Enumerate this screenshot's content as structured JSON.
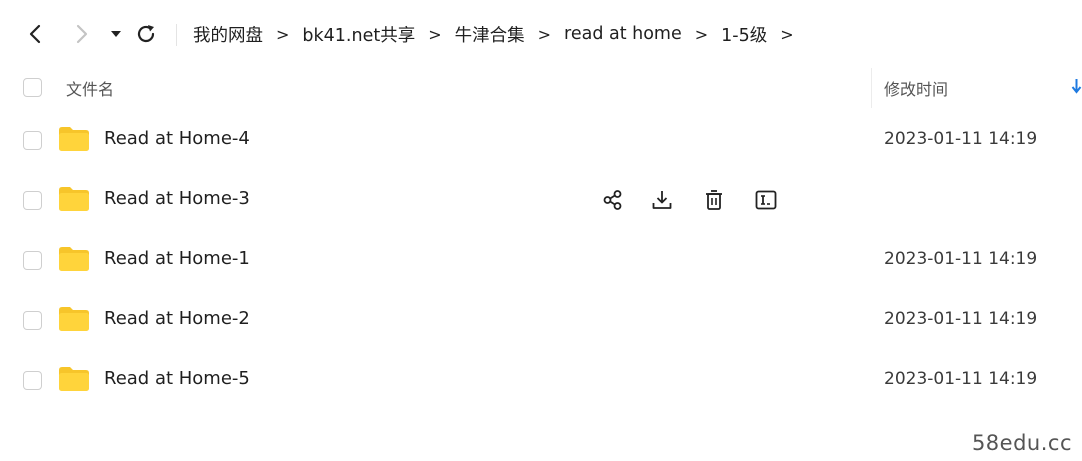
{
  "nav": {
    "back_icon": "chevron-left-icon",
    "forward_icon": "chevron-right-icon",
    "dropdown_icon": "caret-down-icon",
    "refresh_icon": "refresh-icon"
  },
  "breadcrumb": {
    "items": [
      "我的网盘",
      "bk41.net共享",
      "牛津合集",
      "read at home",
      "1-5级"
    ],
    "separator": ">"
  },
  "table": {
    "header_name": "文件名",
    "header_time": "修改时间",
    "sort_icon": "sort-down-icon"
  },
  "rows": [
    {
      "name": "Read at Home-4",
      "time": "2023-01-11 14:19"
    },
    {
      "name": "Read at Home-3",
      "time": ""
    },
    {
      "name": "Read at Home-1",
      "time": "2023-01-11 14:19"
    },
    {
      "name": "Read at Home-2",
      "time": "2023-01-11 14:19"
    },
    {
      "name": "Read at Home-5",
      "time": "2023-01-11 14:19"
    }
  ],
  "row_actions": [
    "share-icon",
    "download-icon",
    "delete-icon",
    "rename-icon"
  ],
  "colors": {
    "folder": "#FFD43B",
    "folder_tab": "#F7C52A",
    "text": "#1f1f1f",
    "checkbox_border": "#cfcfcf",
    "sort_arrow": "#1f7ae0"
  },
  "watermark": "58edu.cc"
}
